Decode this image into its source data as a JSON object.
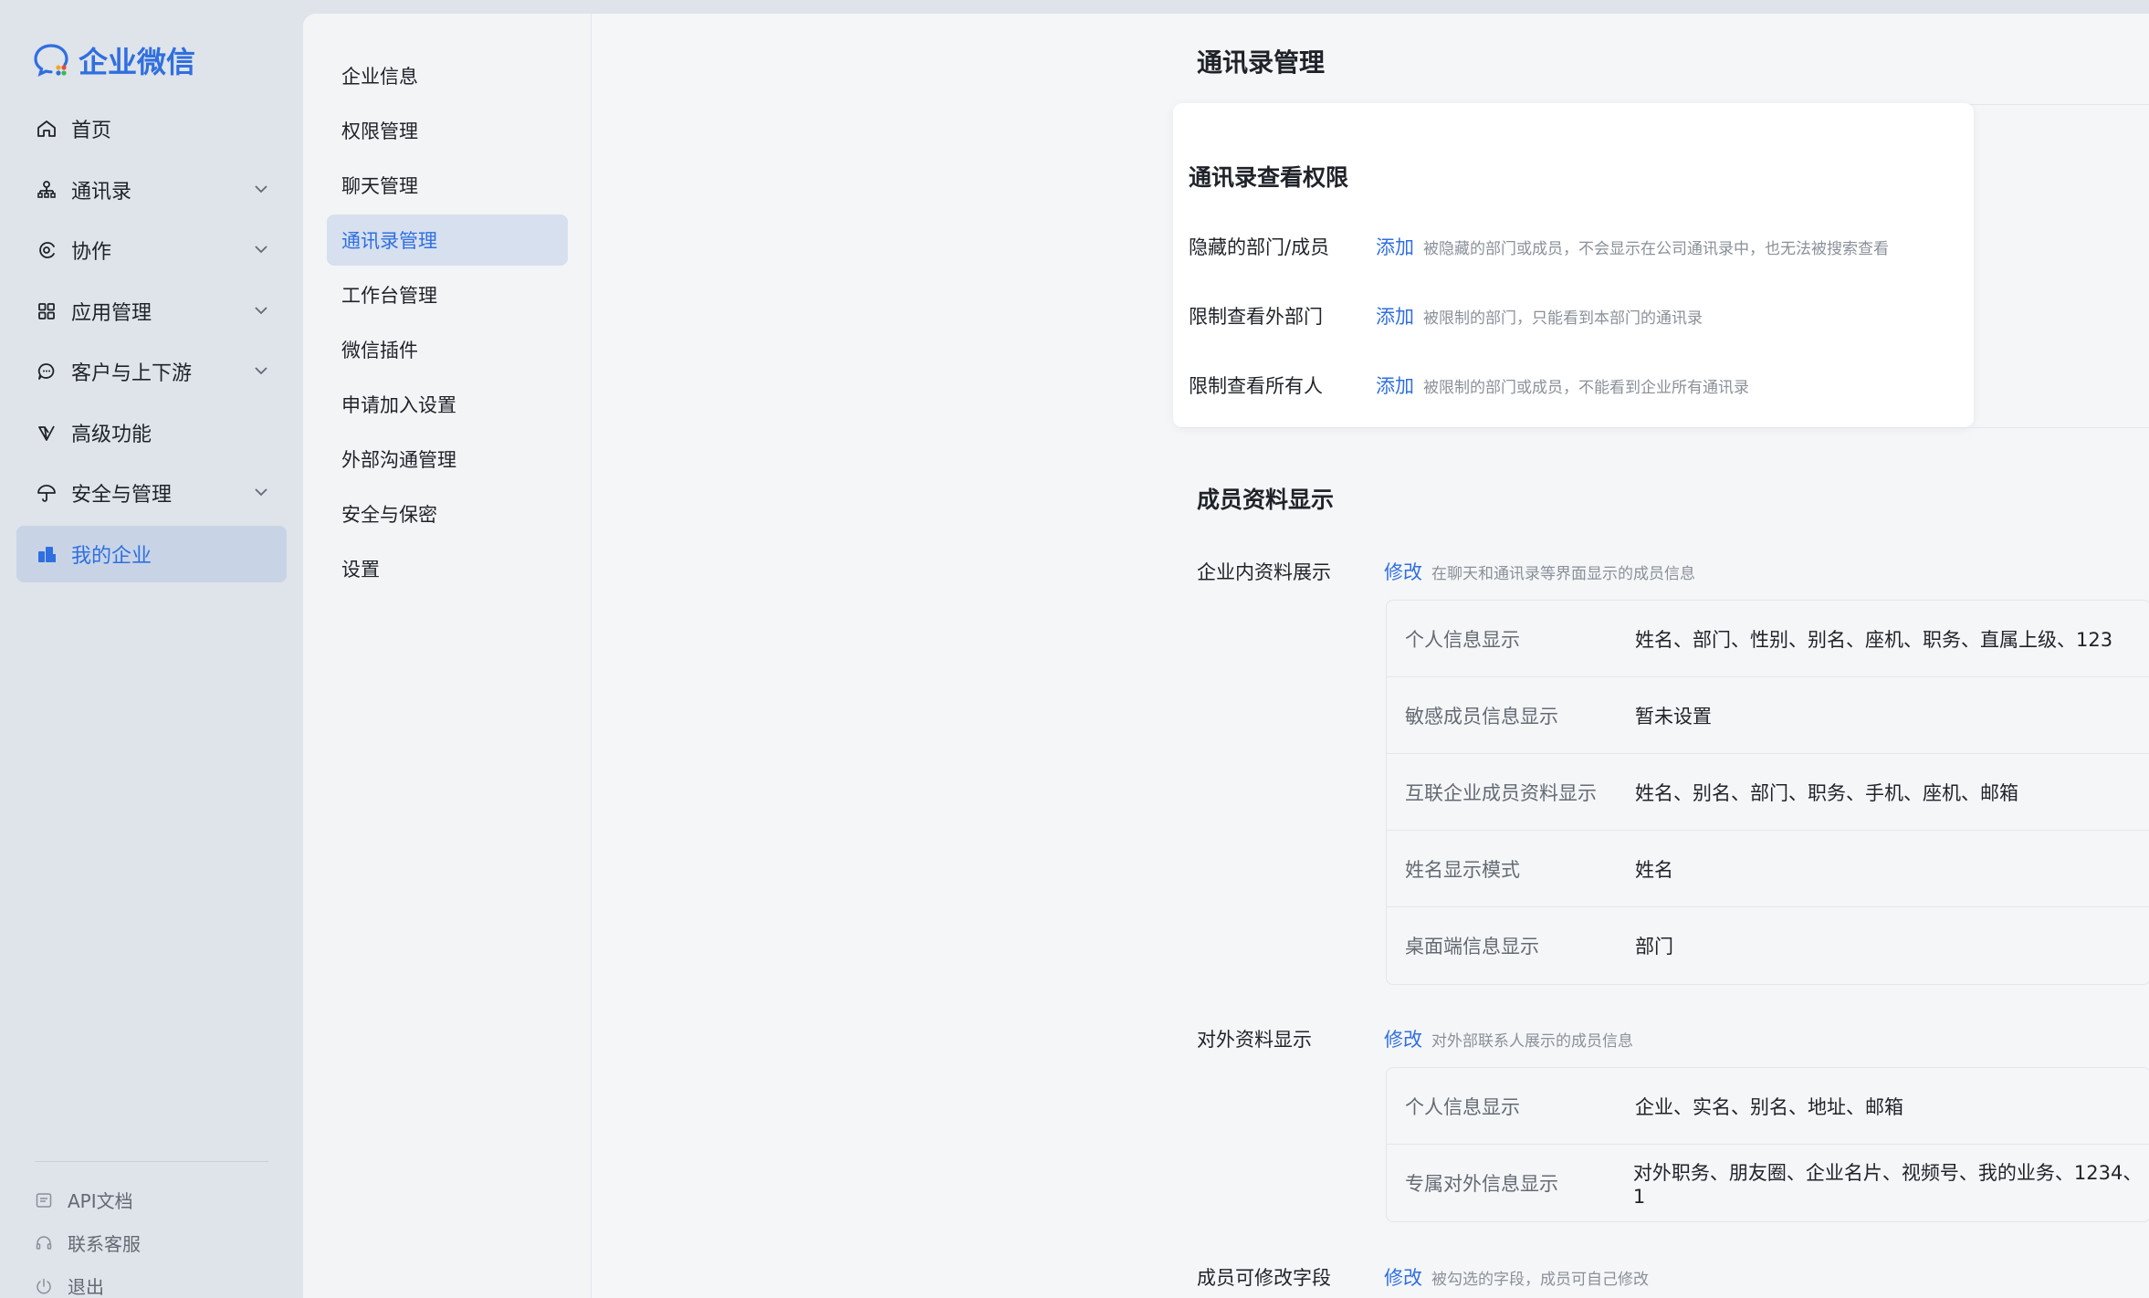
{
  "brand": {
    "name": "企业微信",
    "color": "#2f6fe0"
  },
  "nav": {
    "items": [
      {
        "label": "首页",
        "icon": "home-icon",
        "expandable": false
      },
      {
        "label": "通讯录",
        "icon": "org-chart-icon",
        "expandable": true
      },
      {
        "label": "协作",
        "icon": "collab-icon",
        "expandable": true
      },
      {
        "label": "应用管理",
        "icon": "grid-icon",
        "expandable": true
      },
      {
        "label": "客户与上下游",
        "icon": "chat-bubble-icon",
        "expandable": true
      },
      {
        "label": "高级功能",
        "icon": "diamond-icon",
        "expandable": false
      },
      {
        "label": "安全与管理",
        "icon": "umbrella-icon",
        "expandable": true
      },
      {
        "label": "我的企业",
        "icon": "company-icon",
        "expandable": false,
        "active": true
      }
    ],
    "footer": [
      {
        "label": "API文档",
        "icon": "api-icon"
      },
      {
        "label": "联系客服",
        "icon": "headset-icon"
      },
      {
        "label": "退出",
        "icon": "power-icon"
      }
    ]
  },
  "subnav": {
    "items": [
      "企业信息",
      "权限管理",
      "聊天管理",
      "通讯录管理",
      "工作台管理",
      "微信插件",
      "申请加入设置",
      "外部沟通管理",
      "安全与保密",
      "设置"
    ],
    "active_index": 3
  },
  "page": {
    "title": "通讯录管理"
  },
  "view_permission": {
    "title": "通讯录查看权限",
    "rows": [
      {
        "label": "隐藏的部门/成员",
        "action": "添加",
        "hint": "被隐藏的部门或成员，不会显示在公司通讯录中，也无法被搜索查看"
      },
      {
        "label": "限制查看外部门",
        "action": "添加",
        "hint": "被限制的部门，只能看到本部门的通讯录"
      },
      {
        "label": "限制查看所有人",
        "action": "添加",
        "hint": "被限制的部门或成员，不能看到企业所有通讯录"
      }
    ]
  },
  "member_display": {
    "title": "成员资料显示",
    "internal": {
      "label": "企业内资料展示",
      "action": "修改",
      "hint": "在聊天和通讯录等界面显示的成员信息",
      "rows": [
        {
          "key": "个人信息显示",
          "value": "姓名、部门、性别、别名、座机、职务、直属上级、123"
        },
        {
          "key": "敏感成员信息显示",
          "value": "暂未设置"
        },
        {
          "key": "互联企业成员资料显示",
          "value": "姓名、别名、部门、职务、手机、座机、邮箱"
        },
        {
          "key": "姓名显示模式",
          "value": "姓名"
        },
        {
          "key": "桌面端信息显示",
          "value": "部门"
        }
      ]
    },
    "external": {
      "label": "对外资料显示",
      "action": "修改",
      "hint": "对外部联系人展示的成员信息",
      "rows": [
        {
          "key": "个人信息显示",
          "value": "企业、实名、别名、地址、邮箱"
        },
        {
          "key": "专属对外信息显示",
          "value": "对外职务、朋友圈、企业名片、视频号、我的业务、1234、1"
        }
      ]
    },
    "editable": {
      "label": "成员可修改字段",
      "action": "修改",
      "hint": "被勾选的字段，成员可自己修改"
    }
  }
}
